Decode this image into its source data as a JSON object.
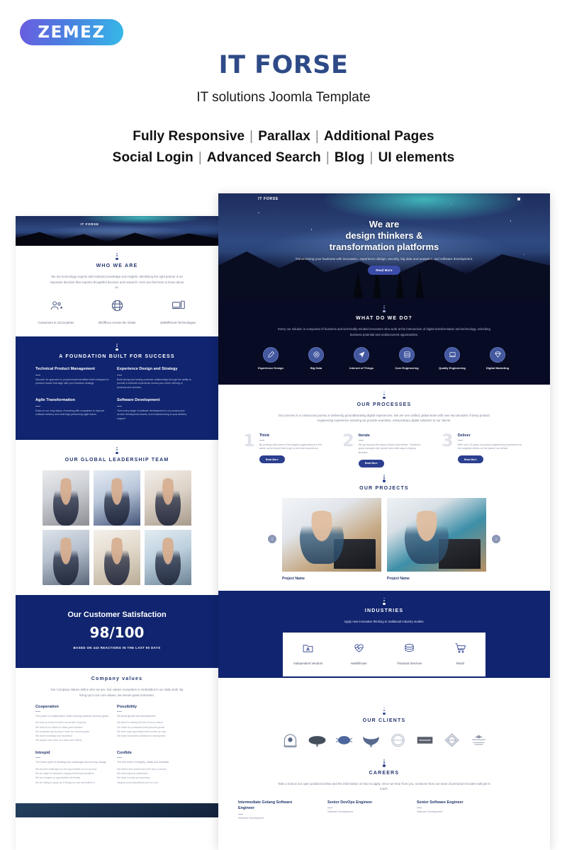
{
  "brand": {
    "logo_text": "ZEMEZ"
  },
  "header": {
    "title": "IT FORSE",
    "subtitle": "IT solutions  Joomla Template",
    "features_line_1": [
      "Fully Responsive",
      "Parallax",
      "Additional Pages"
    ],
    "features_line_2": [
      "Social Login",
      "Advanced Search",
      "Blog",
      "UI elements"
    ],
    "separator": "|"
  },
  "colors": {
    "title_blue": "#2e4a87",
    "navy": "#10246f",
    "dark": "#080b24",
    "accent_button": "#3a4ba8",
    "heading_blue": "#23366e",
    "logo_gradient_from": "#6b5ce0",
    "logo_gradient_to": "#35b9e8"
  },
  "preview_right": {
    "nav_brand": "IT FORSE",
    "hero": {
      "line1": "We are",
      "line2": "design thinkers &",
      "line3": "transformation platforms",
      "paragraph": "Transforming your business with innovation, experience design, security, big data and analytics, and software development.",
      "button": "Read More"
    },
    "what_we_do": {
      "title": "WHAT DO WE DO?",
      "lead": "Every our solution is composed of business and technically-minded innovators who work at the intersection of digital transformation and technology, unlocking business potential and undiscovered opportunities.",
      "items": [
        {
          "label": "Experience Design",
          "icon": "pencil-icon"
        },
        {
          "label": "Big Data",
          "icon": "gear-icon"
        },
        {
          "label": "Internet of Things",
          "icon": "paper-plane-icon"
        },
        {
          "label": "Core Engineering",
          "icon": "server-icon"
        },
        {
          "label": "Quality Engineering",
          "icon": "laptop-icon"
        },
        {
          "label": "Digital Marketing",
          "icon": "diamond-icon"
        }
      ]
    },
    "processes": {
      "title": "OUR PROCESSES",
      "lead": "Our process is a continuous journey in delivering groundbreaking digital experiences. We are one unified, global team with over two decades of deep product engineering experience ensuring we provide seamless, extraordinary digital solutions to our clients.",
      "steps": [
        {
          "number": "1",
          "heading": "Think",
          "text": "By working with some of the largest organizations in the world, we've found that to get to the best experience.",
          "button": "Read More"
        },
        {
          "number": "2",
          "heading": "Iterate",
          "text": "We go beyond the steps of think and deliver. Transform good concepts into 'great' ones with easy to deploy iteration.",
          "button": "Read More"
        },
        {
          "number": "3",
          "heading": "Deliver",
          "text": "With over 20 years of product engineering experience for the toughest clients on the planet, we deliver.",
          "button": "Read More"
        }
      ]
    },
    "projects": {
      "title": "OUR PROJECTS",
      "prev_icon": "chevron-left-icon",
      "next_icon": "chevron-right-icon",
      "items": [
        {
          "name": "Project Name"
        },
        {
          "name": "Project Name"
        }
      ]
    },
    "industries": {
      "title": "INDUSTRIES",
      "lead": "Apply new innovative thinking to traditional industry models.",
      "items": [
        {
          "label": "Independent Vendors",
          "icon": "folder-user-icon"
        },
        {
          "label": "Healthhcare",
          "icon": "heart-pulse-icon"
        },
        {
          "label": "Financial Services",
          "icon": "coins-icon"
        },
        {
          "label": "Retail",
          "icon": "shopping-cart-icon"
        }
      ]
    },
    "clients": {
      "title": "OUR CLIENTS",
      "logos": [
        "client-logo-1",
        "client-logo-2",
        "client-logo-3",
        "client-logo-4",
        "client-logo-5",
        "client-logo-6",
        "client-logo-7",
        "client-logo-8"
      ]
    },
    "careers": {
      "title": "CAREERS",
      "lead": "Take a look at our open positions below and the information on how to apply. Once we hear from you, someone from our team of personal recruiters will get in touch.",
      "positions": [
        {
          "title": "Intermediate Golang Software Engineer",
          "dept": "Software Development"
        },
        {
          "title": "Senior DevOps Engineer",
          "dept": "Software Development"
        },
        {
          "title": "Senior Software Engineer",
          "dept": "Software Development"
        }
      ]
    }
  },
  "preview_left": {
    "nav_brand": "IT FORSE",
    "who_we_are": {
      "title": "WHO WE ARE",
      "lead": "We are technology experts with industry knowledge and insights. Identifying the right partner is an important decision that requires thoughtful decision and research. Here are fast facts to know about us.",
      "stats": [
        {
          "label": "Customers in 12Countries",
          "icon": "users-icon"
        },
        {
          "label": "30Offices Across the Globe",
          "icon": "globe-icon"
        },
        {
          "label": "150Different Technologies",
          "icon": "devices-icon"
        }
      ]
    },
    "foundation": {
      "title": "A FOUNDATION BUILT FOR SUCCESS",
      "items": [
        {
          "heading": "Technical Product Management",
          "text": "Discover an approach to product implementation that's designed to produce results that align with your business strategy."
        },
        {
          "heading": "Experience Design and Strategy",
          "text": "Build strong and lasting customer relationships through the ability to provide a cohesive experience across your entire offering of products and services."
        },
        {
          "heading": "Agile Transformation",
          "text": "Draw on our long history of working with companies to improve software delivery and build high-performing agile teams."
        },
        {
          "heading": "Software Development",
          "text": "Trust every stage of software development to our product and service development teams, from brainstorming to post delivery support."
        }
      ]
    },
    "team": {
      "title": "OUR GLOBAL LEADERSHIP TEAM",
      "members": [
        "member-photo-1",
        "member-photo-2",
        "member-photo-3",
        "member-photo-4",
        "member-photo-5",
        "member-photo-6"
      ]
    },
    "satisfaction": {
      "heading": "Our Customer Satisfaction",
      "score": "98/100",
      "subtext": "BASED ON 443 REACTIONS IN THE LAST 90 DAYS"
    },
    "values": {
      "title": "Company values",
      "lead": "Our Company Values define who we are. Our values ecosystem is embedded in our daily work. By living up to our core values, we ensure great outcomes.",
      "items": [
        {
          "heading": "Cooperation",
          "text": "The power of collaboration while working towards common goals",
          "bullets": [
            "We work as a team to build a successful Company",
            "We unite all our efforts to create great solutions",
            "We cooperate day-by-day to reach our common goals",
            "We share knowledge and experience",
            "We support each other as a team and a family"
          ]
        },
        {
          "heading": "Possibility",
          "text": "Personal growth and development",
          "bullets": [
            "We strive for making the best of every chance",
            "Our desire for professional and personal growth",
            "We seize each opportunity which comes our way",
            "We foster favourable conditions for development"
          ]
        },
        {
          "heading": "Intrepid",
          "text": "The brave spirit of meeting new challenges and driving change",
          "bullets": [
            "We perceive challenges as new opportunities for our success",
            "We are eager for disruptive changes that bring innovations",
            "We see changes as opportunities not threats",
            "We are willing to speak up for things we care and believe in"
          ]
        },
        {
          "heading": "Confide",
          "text": "The firm belief in integrity, ability and reliability",
          "bullets": [
            "We believe that mutual trust is the key to success",
            "We build long-term partnership",
            "We foster honesty and openness",
            "Integrity and trustworthiness are our core"
          ]
        }
      ]
    }
  }
}
